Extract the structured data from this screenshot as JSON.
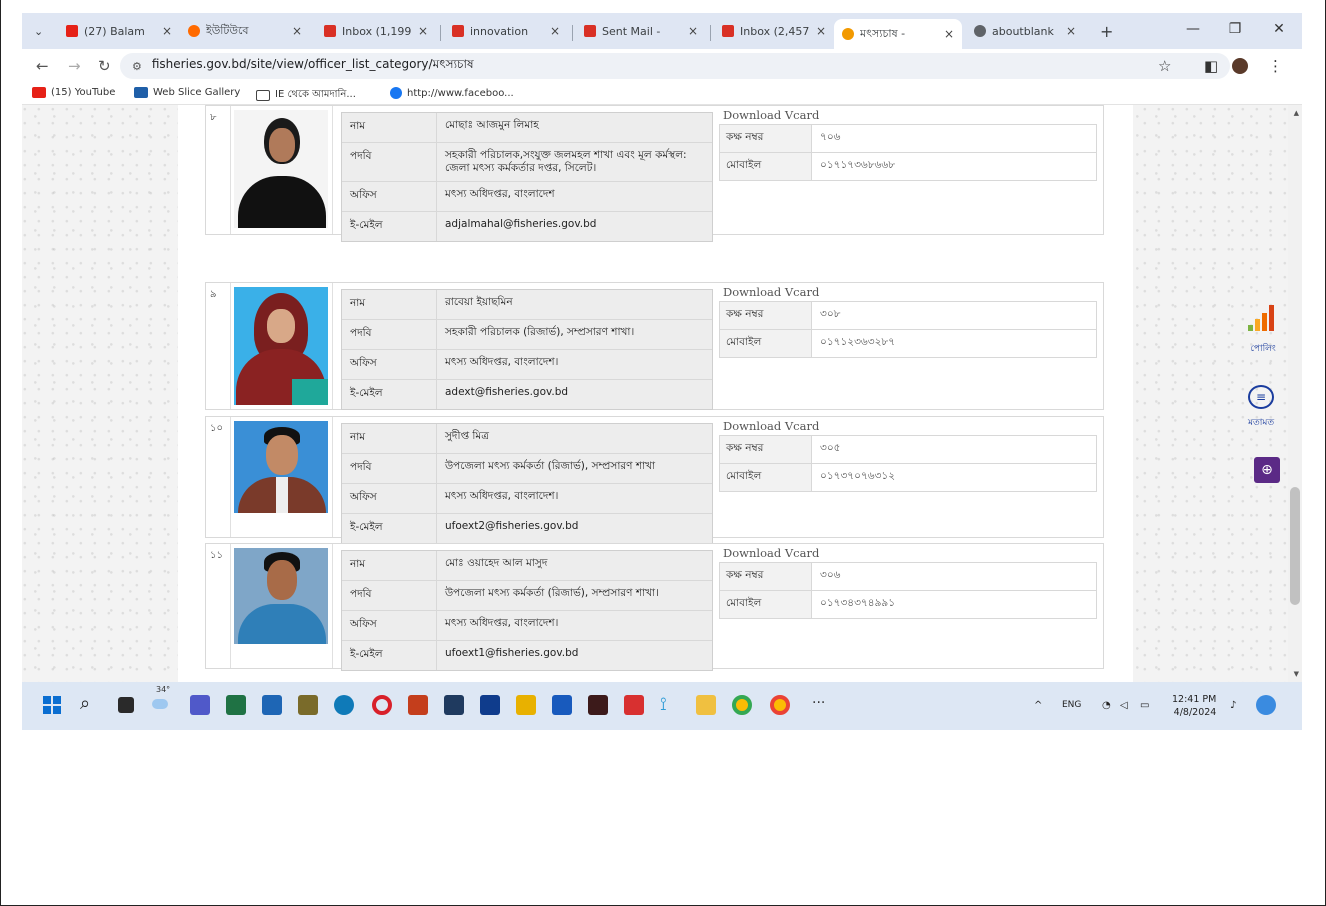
{
  "browser": {
    "tabs": [
      {
        "label": "(27) Balam",
        "close": "×",
        "favicon_color": "#e62117"
      },
      {
        "label": "ইউটিউবে",
        "close": "×",
        "favicon_color": "#ff6a00"
      },
      {
        "label": "Inbox (1,199",
        "close": "×",
        "favicon_color": "#d93025"
      },
      {
        "label": "innovation",
        "close": "×",
        "favicon_color": "#d93025"
      },
      {
        "label": "Sent Mail -",
        "close": "×",
        "favicon_color": "#d93025"
      },
      {
        "label": "Inbox (2,457",
        "close": "×",
        "favicon_color": "#d93025"
      },
      {
        "label": "মৎস্যচাষ -",
        "close": "×",
        "favicon_color": "#f29900",
        "active": true
      },
      {
        "label": "aboutblank",
        "close": "×",
        "favicon_color": "#5f6368"
      }
    ],
    "new_tab": "+",
    "window_controls": {
      "minimize": "—",
      "restore": "❐",
      "close": "✕"
    },
    "url": "fisheries.gov.bd/site/view/officer_list_category/মৎস্যচাষ",
    "bookmarks": [
      {
        "label": "(15) YouTube",
        "color": "#e62117"
      },
      {
        "label": "Web Slice Gallery",
        "color": "#1f5fa8"
      },
      {
        "label": "IE থেকে আমদানি...",
        "color": "#444444"
      },
      {
        "label": "http://www.faceboo...",
        "color": "#1877f2"
      }
    ]
  },
  "page": {
    "download_vcard": "Download Vcard",
    "labels": {
      "name": "নাম",
      "designation": "পদবি",
      "office": "অফিস",
      "email": "ই-মেইল",
      "room": "কক্ষ নম্বর",
      "mobile": "মোবাইল"
    },
    "officers": [
      {
        "serial": "৮",
        "name": "মোছাঃ আজমুন লিমাহ",
        "designation": "সহকারী পরিচালক,সংযুক্ত জলমহল শাখা এবং মূল কর্মস্থল: জেলা মৎস্য কর্মকর্তার দপ্তর, সিলেট।",
        "office": "মৎস্য অধিদপ্তর, বাংলাদেশ",
        "email": "adjalmahal@fisheries.gov.bd",
        "room": "৭০৬",
        "mobile": "০১৭১৭৩৬৮৬৬৮"
      },
      {
        "serial": "৯",
        "name": "রাবেয়া ইয়াছমিন",
        "designation": "সহকারী পরিচালক (রিজার্ভ), সম্প্রসারণ শাখা।",
        "office": "মৎস্য অধিদপ্তর, বাংলাদেশ।",
        "email": "adext@fisheries.gov.bd",
        "room": "৩০৮",
        "mobile": "০১৭১২৩৬৩২৮৭"
      },
      {
        "serial": "১০",
        "name": "সুদীপ্ত মিত্র",
        "designation": "উপজেলা মৎস্য কর্মকর্তা (রিজার্ভ), সম্প্রসারণ শাখা",
        "office": "মৎস্য অধিদপ্তর, বাংলাদেশ।",
        "email": "ufoext2@fisheries.gov.bd",
        "room": "৩০৫",
        "mobile": "০১৭৩৭০৭৬৩১২"
      },
      {
        "serial": "১১",
        "name": "মোঃ ওয়াহেদ আল মাসুদ",
        "designation": "উপজেলা মৎস্য কর্মকর্তা (রিজার্ভ), সম্প্রসারণ শাখা।",
        "office": "মৎস্য অধিদপ্তর, বাংলাদেশ।",
        "email": "ufoext1@fisheries.gov.bd",
        "room": "৩০৬",
        "mobile": "০১৭৩৪৩৭৪৯৯১"
      }
    ],
    "side_widgets": {
      "poll_label": "পোলিং",
      "feedback_label": "মতামত"
    }
  },
  "taskbar": {
    "weather": "34°",
    "tray_lang": "ENG",
    "time": "12:41 PM",
    "date": "4/8/2024",
    "more": "···"
  }
}
